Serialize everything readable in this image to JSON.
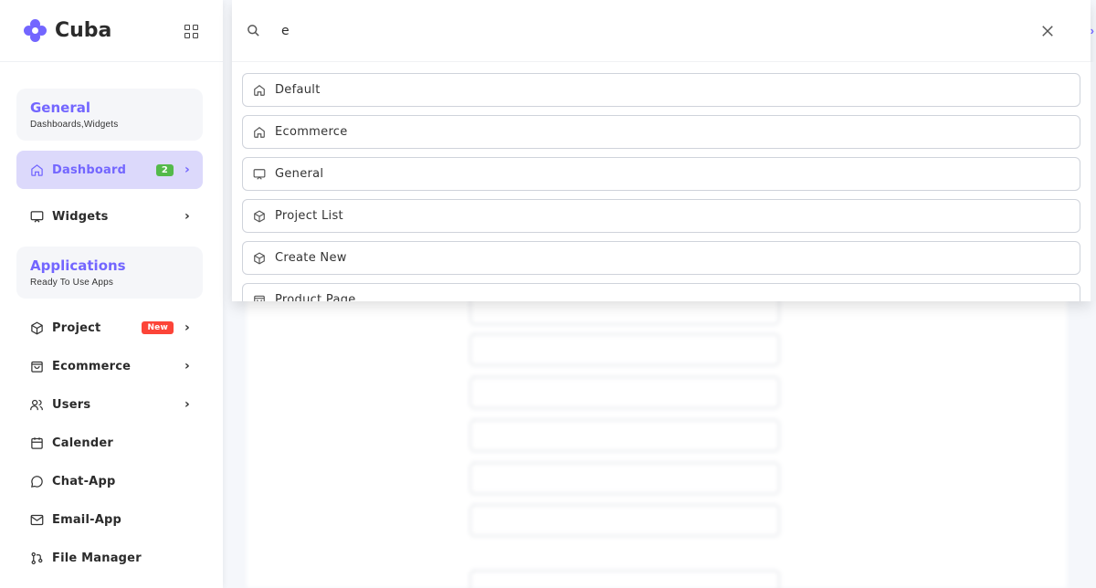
{
  "brand": {
    "name": "Cuba",
    "color": "#7366ff"
  },
  "sidebar": {
    "sections": [
      {
        "title": "General",
        "subtitle": "Dashboards,Widgets"
      },
      {
        "title": "Applications",
        "subtitle": "Ready To Use Apps"
      }
    ],
    "items": [
      {
        "label": "Dashboard",
        "icon": "home-icon",
        "badge": "2",
        "active": true
      },
      {
        "label": "Widgets",
        "icon": "monitor-icon"
      },
      {
        "label": "Project",
        "icon": "box-icon",
        "badge": "New"
      },
      {
        "label": "Ecommerce",
        "icon": "shopping-bag-icon"
      },
      {
        "label": "Users",
        "icon": "users-icon"
      },
      {
        "label": "Calender",
        "icon": "calendar-icon"
      },
      {
        "label": "Chat-App",
        "icon": "chat-icon"
      },
      {
        "label": "Email-App",
        "icon": "mail-icon"
      },
      {
        "label": "File Manager",
        "icon": "git-branch-icon"
      }
    ]
  },
  "search": {
    "value": "e",
    "results": [
      {
        "label": "Default",
        "icon": "home-icon"
      },
      {
        "label": "Ecommerce",
        "icon": "home-icon"
      },
      {
        "label": "General",
        "icon": "monitor-icon"
      },
      {
        "label": "Project List",
        "icon": "box-icon"
      },
      {
        "label": "Create New",
        "icon": "box-icon"
      },
      {
        "label": "Product Page",
        "icon": "shopping-bag-icon"
      }
    ]
  },
  "colors": {
    "accent": "#7366ff",
    "active_bg": "#dcd9fb",
    "badge_green": "#54ba4a",
    "badge_red": "#fc4438"
  }
}
